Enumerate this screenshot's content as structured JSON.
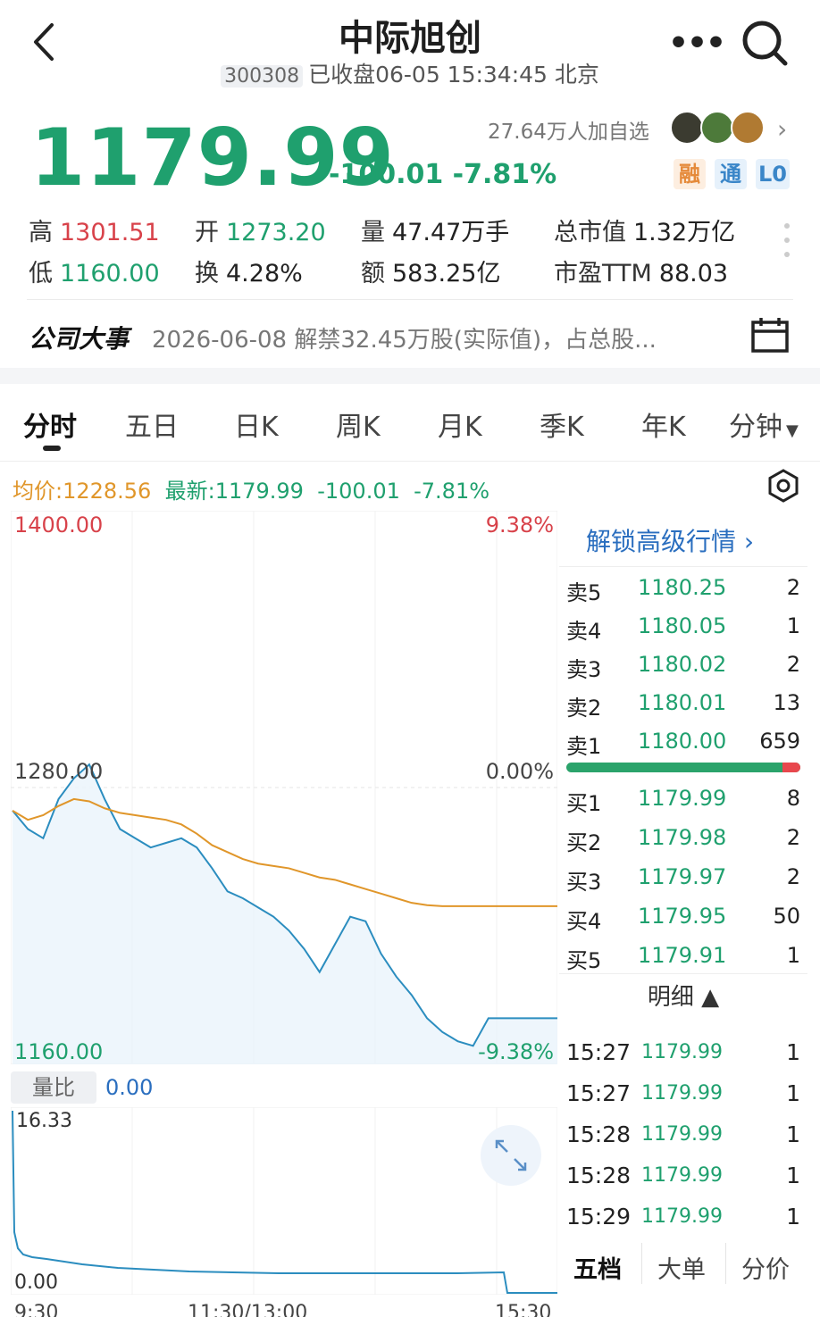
{
  "header": {
    "title": "中际旭创",
    "code": "300308",
    "status": "已收盘06-05 15:34:45 北京"
  },
  "quote": {
    "price": "1179.99",
    "change": "-100.01 -7.81%",
    "watch": "27.64万人加自选",
    "tags": [
      "融",
      "通",
      "L0"
    ]
  },
  "stats": {
    "high_label": "高",
    "high": "1301.51",
    "low_label": "低",
    "low": "1160.00",
    "open_label": "开",
    "open": "1273.20",
    "turnover_label": "换",
    "turnover": "4.28%",
    "volume_label": "量",
    "volume": "47.47万手",
    "amount_label": "额",
    "amount": "583.25亿",
    "mktcap_label": "总市值",
    "mktcap": "1.32万亿",
    "pe_label": "市盈TTM",
    "pe": "88.03"
  },
  "event": {
    "title": "公司大事",
    "text": "2026-06-08 解禁32.45万股(实际值)，占总股..."
  },
  "tabs": [
    "分时",
    "五日",
    "日K",
    "周K",
    "月K",
    "季K",
    "年K",
    "分钟"
  ],
  "infoline": {
    "avg": "均价:1228.56",
    "latest": "最新:1179.99",
    "change": "-100.01",
    "pct": "-7.81%"
  },
  "chart_labels": {
    "price_max": "1400.00",
    "pct_max": "9.38%",
    "price_mid": "1280.00",
    "pct_mid": "0.00%",
    "price_min": "1160.00",
    "pct_min": "-9.38%",
    "volume_ratio_label": "量比",
    "volume_ratio": "0.00",
    "vr_max": "16.33",
    "vr_min": "0.00",
    "t_start": "9:30",
    "t_mid": "11:30/13:00",
    "t_end": "15:30"
  },
  "orderbook": {
    "unlock": "解锁高级行情 ›",
    "asks": [
      {
        "label": "卖5",
        "price": "1180.25",
        "vol": "2"
      },
      {
        "label": "卖4",
        "price": "1180.05",
        "vol": "1"
      },
      {
        "label": "卖3",
        "price": "1180.02",
        "vol": "2"
      },
      {
        "label": "卖2",
        "price": "1180.01",
        "vol": "13"
      },
      {
        "label": "卖1",
        "price": "1180.00",
        "vol": "659"
      }
    ],
    "bids": [
      {
        "label": "买1",
        "price": "1179.99",
        "vol": "8"
      },
      {
        "label": "买2",
        "price": "1179.98",
        "vol": "2"
      },
      {
        "label": "买3",
        "price": "1179.97",
        "vol": "2"
      },
      {
        "label": "买4",
        "price": "1179.95",
        "vol": "50"
      },
      {
        "label": "买5",
        "price": "1179.91",
        "vol": "1"
      }
    ],
    "detail_header": "明细 ▲",
    "ticks": [
      {
        "time": "15:27",
        "price": "1179.99",
        "vol": "1"
      },
      {
        "time": "15:27",
        "price": "1179.99",
        "vol": "1"
      },
      {
        "time": "15:28",
        "price": "1179.99",
        "vol": "1"
      },
      {
        "time": "15:28",
        "price": "1179.99",
        "vol": "1"
      },
      {
        "time": "15:29",
        "price": "1179.99",
        "vol": "1"
      }
    ],
    "bottom_tabs": [
      "五档",
      "大单",
      "分价"
    ]
  },
  "chart_data": {
    "type": "line",
    "ylim": [
      1160,
      1400
    ],
    "reference": 1280,
    "series": [
      {
        "values": [
          1270,
          1262,
          1258,
          1275,
          1284,
          1290,
          1275,
          1262,
          1258,
          1254,
          1256,
          1258,
          1254,
          1245,
          1235,
          1232,
          1228,
          1224,
          1218,
          1210,
          1200,
          1212,
          1224,
          1222,
          1208,
          1198,
          1190,
          1180,
          1174,
          1170,
          1168,
          1179.99,
          1179.99
        ]
      },
      {
        "values": [
          1270,
          1266,
          1268,
          1272,
          1275,
          1274,
          1271,
          1269,
          1268,
          1267,
          1266,
          1264,
          1260,
          1255,
          1252,
          1249,
          1247,
          1246,
          1245,
          1243,
          1241,
          1240,
          1238,
          1236,
          1234,
          1232,
          1230,
          1229,
          1228.56,
          1228.56,
          1228.56,
          1228.56,
          1228.56
        ]
      }
    ]
  },
  "colors": {
    "up": "#d8424a",
    "down": "#1fa06e",
    "price_line": "#2b8dbf",
    "avg_line": "#e0962a",
    "link": "#2a6ebf"
  }
}
